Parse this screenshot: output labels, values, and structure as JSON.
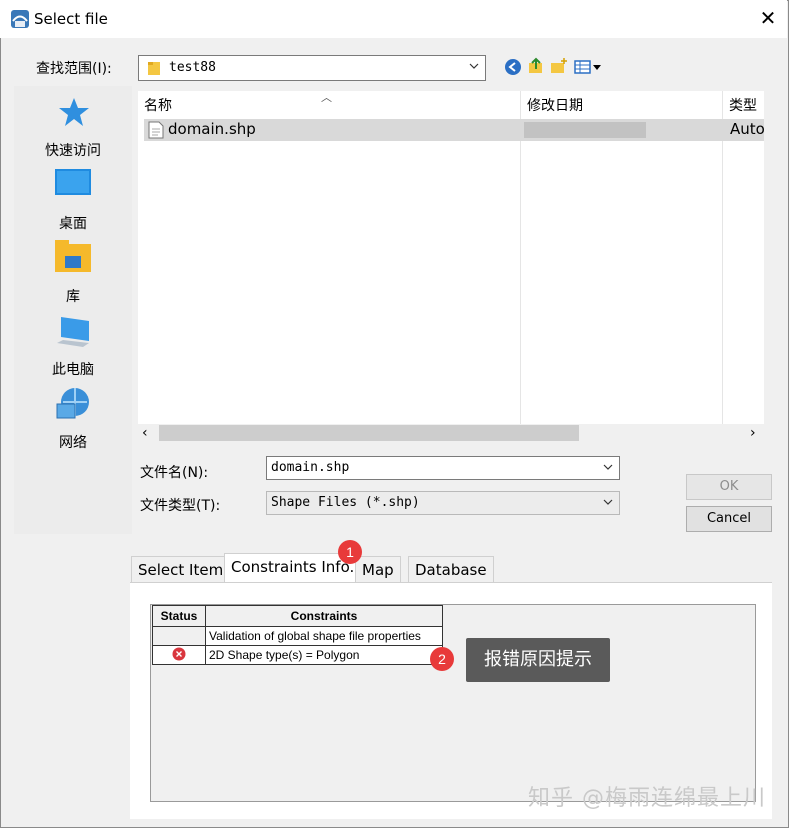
{
  "window": {
    "title": "Select file",
    "close_glyph": "✕"
  },
  "lookin": {
    "label": "查找范围(I):",
    "value": "test88"
  },
  "places": [
    {
      "label": "快速访问",
      "icon": "star-icon"
    },
    {
      "label": "桌面",
      "icon": "desktop-icon"
    },
    {
      "label": "库",
      "icon": "library-icon"
    },
    {
      "label": "此电脑",
      "icon": "computer-icon"
    },
    {
      "label": "网络",
      "icon": "network-icon"
    }
  ],
  "filelist": {
    "columns": [
      "名称",
      "修改日期",
      "类型"
    ],
    "rows": [
      {
        "name": "domain.shp",
        "type": "Auto"
      }
    ]
  },
  "filename": {
    "label": "文件名(N):",
    "value": "domain.shp"
  },
  "filetype": {
    "label": "文件类型(T):",
    "value": "Shape Files (*.shp)"
  },
  "buttons": {
    "ok": "OK",
    "cancel": "Cancel"
  },
  "tabs": [
    "Select Item",
    "Constraints Info.",
    "Map",
    "Database"
  ],
  "constraints": {
    "headers": [
      "Status",
      "Constraints"
    ],
    "rows": [
      "Validation of global shape file properties",
      "2D Shape type(s) = Polygon"
    ]
  },
  "annotations": {
    "badge1": "1",
    "badge2": "2",
    "tooltip": "报错原因提示"
  },
  "watermark": "知乎 @梅雨连绵最上川",
  "colors": {
    "badge": "#e83a3a",
    "error": "#d9363e"
  }
}
